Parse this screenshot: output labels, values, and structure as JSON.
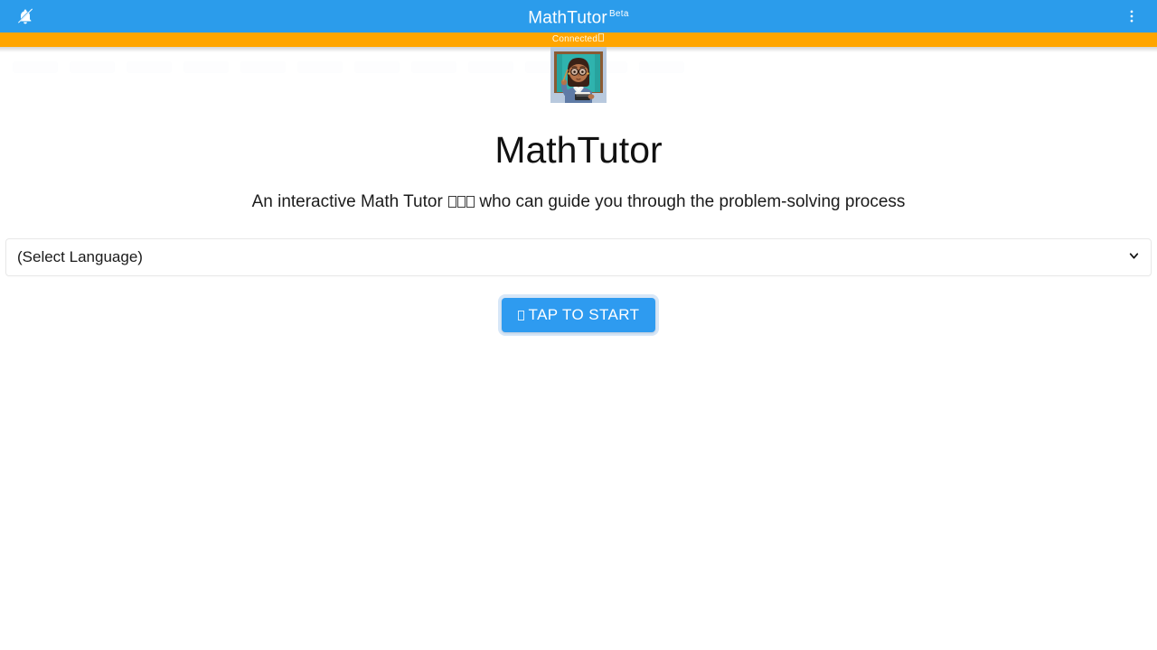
{
  "appbar": {
    "title": "MathTutor",
    "badge": "Beta",
    "bell_icon": "bell-off-icon",
    "menu_icon": "more-vertical-icon",
    "bg_color": "#2b9ceb"
  },
  "status": {
    "text": "Connected",
    "trailing_glyph": "□",
    "bg_color": "#ffa500",
    "text_color": "#fffbe8"
  },
  "hero": {
    "avatar_alt": "teacher-avatar",
    "title": "MathTutor",
    "subtitle_before": "An interactive Math Tutor",
    "subtitle_after": "who can guide you through the problem-solving process",
    "missing_glyph_count": 3
  },
  "language": {
    "selected": "(Select Language)",
    "chevron_icon": "chevron-down-icon",
    "options": [
      "(Select Language)"
    ]
  },
  "start": {
    "label": "TAP TO START",
    "bg_color": "#2e9bf0",
    "text_color": "#ffffff",
    "leading_glyph": "□"
  },
  "ghost_chips": {
    "count": 12
  }
}
